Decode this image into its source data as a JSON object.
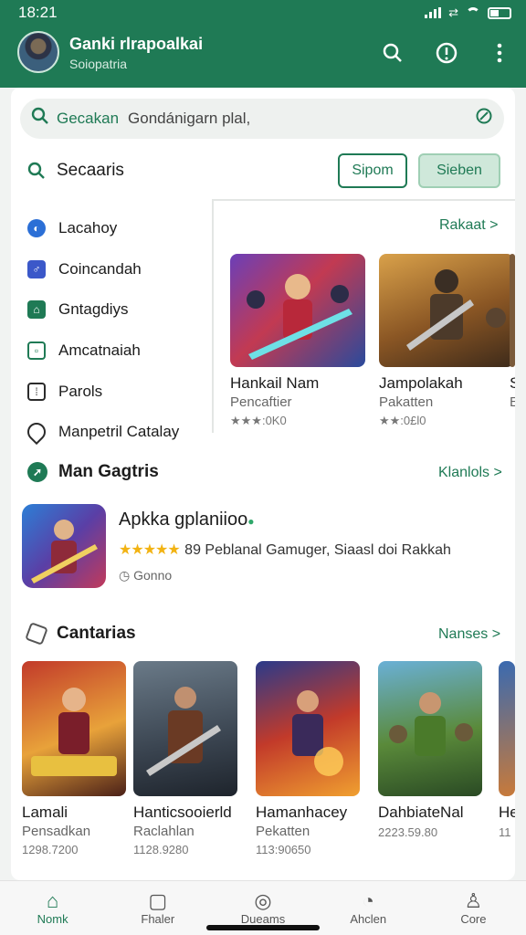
{
  "status_bar": {
    "time": "18:21"
  },
  "header": {
    "title": "Ganki rlrapoalkai",
    "subtitle": "Soiopatria"
  },
  "search": {
    "hint": "Gecakan",
    "value": "Gondánigarn plal,"
  },
  "categories": {
    "title": "Secaaris",
    "filter_outline": "Sipom",
    "filter_filled": "Sieben",
    "items": [
      {
        "label": "Lacahoy",
        "icon": "circle-icon",
        "color": "#2b6fd6"
      },
      {
        "label": "Coincandah",
        "icon": "gamepad-icon",
        "color": "#3b58c9"
      },
      {
        "label": "Gntagdiys",
        "icon": "home-icon",
        "color": "#1f7a55"
      },
      {
        "label": "Amcatnaiah",
        "icon": "square-icon",
        "color": "#1f7a55"
      },
      {
        "label": "Parols",
        "icon": "grid-icon",
        "color": "#2b2b2b"
      },
      {
        "label": "Manpetril Catalay",
        "icon": "pin-icon",
        "color": "#2b2b2b"
      }
    ]
  },
  "featured": {
    "more_link": "Rakaat >",
    "tiles": [
      {
        "name": "Hankail Nam",
        "publisher": "Pencaftier",
        "meta": "★★★:0K0"
      },
      {
        "name": "Jampolakah",
        "publisher": "Pakatten",
        "meta": "★★:0£l0"
      },
      {
        "name": "S",
        "publisher": "E",
        "meta": ""
      }
    ]
  },
  "top_app": {
    "section_title": "Man Gagtris",
    "more_link": "Klanlols >",
    "name": "Apkka gplaniioo",
    "desc": "Peblanal Gamuger, Siaasl doi Rakkah",
    "rating_prefix": "89",
    "size": "Gonno"
  },
  "games": {
    "section_title": "Cantarias",
    "more_link": "Nanses >",
    "tiles": [
      {
        "name": "Lamali",
        "publisher": "Pensadkan",
        "meta": "1298.7200"
      },
      {
        "name": "Hanticsooierld",
        "publisher": "Raclahlan",
        "meta": "1128.9280"
      },
      {
        "name": "Hamanhacey",
        "publisher": "Pekatten",
        "meta": "113:90650"
      },
      {
        "name": "DahbiateNal",
        "publisher": "",
        "meta": "2223.59.80"
      },
      {
        "name": "He",
        "publisher": "",
        "meta": "11"
      }
    ]
  },
  "bottom_nav": [
    {
      "label": "Nomk",
      "icon": "home-icon"
    },
    {
      "label": "Fhaler",
      "icon": "bag-icon"
    },
    {
      "label": "Dueams",
      "icon": "compass-icon"
    },
    {
      "label": "Ahclen",
      "icon": "gauge-icon"
    },
    {
      "label": "Core",
      "icon": "person-icon"
    }
  ],
  "colors": {
    "brand": "#1f7a55",
    "star": "#f2b313"
  }
}
